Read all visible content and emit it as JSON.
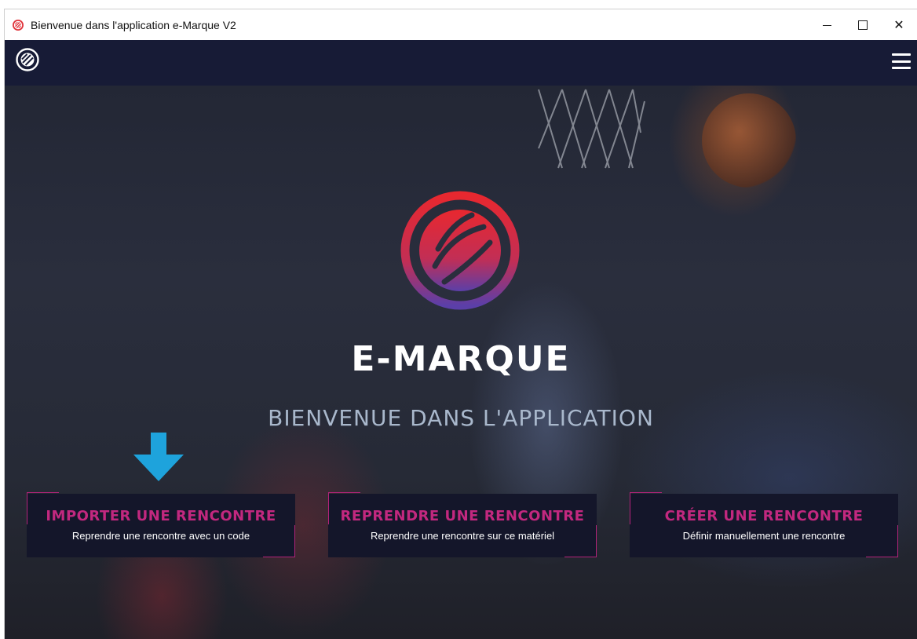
{
  "window": {
    "title": "Bienvenue dans l'application e-Marque V2",
    "controls": {
      "minimize": "minimize",
      "maximize": "maximize",
      "close": "✕"
    }
  },
  "header": {
    "logo_icon": "basketball-logo-icon",
    "menu_icon": "hamburger-menu-icon"
  },
  "hero": {
    "brand": "E-MARQUE",
    "tagline": "BIENVENUE DANS L'APPLICATION"
  },
  "actions": [
    {
      "title": "IMPORTER UNE RENCONTRE",
      "subtitle": "Reprendre une rencontre avec un code"
    },
    {
      "title": "REPRENDRE UNE RENCONTRE",
      "subtitle": "Reprendre une rencontre sur ce matériel"
    },
    {
      "title": "CRÉER UNE RENCONTRE",
      "subtitle": "Définir manuellement une rencontre"
    }
  ],
  "colors": {
    "appbar": "#171b36",
    "accent": "#c2287f",
    "tagline": "#a9b8cc",
    "arrow": "#1ea3dc",
    "logo_gradient_top": "#e8282f",
    "logo_gradient_bottom": "#5b3fa8"
  },
  "icons": {
    "arrow": "down-arrow-icon"
  }
}
